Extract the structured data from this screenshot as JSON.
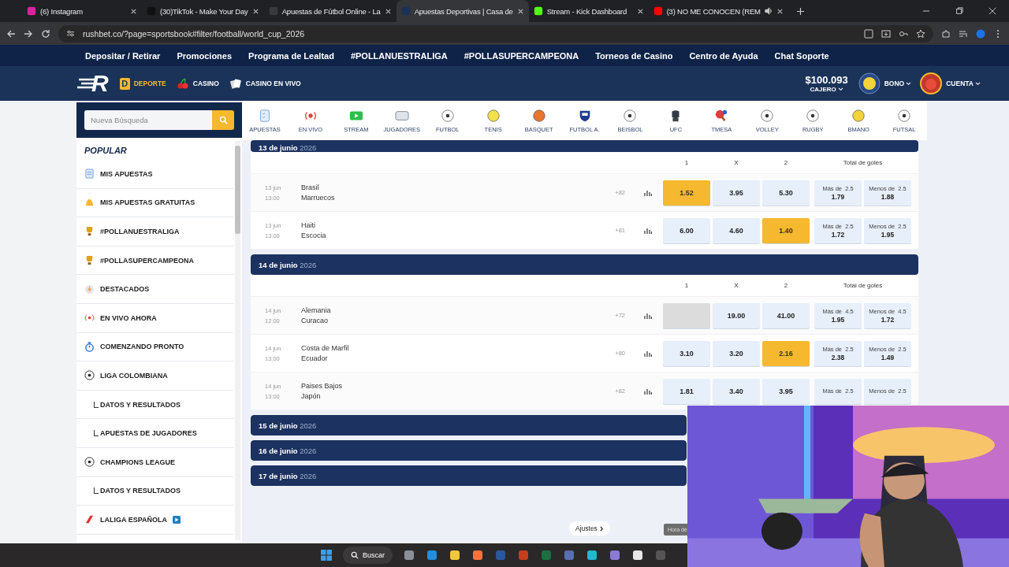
{
  "browser": {
    "tabs": [
      {
        "title": "(6) Instagram",
        "kind": "instagram",
        "selected": false,
        "audio": false
      },
      {
        "title": "(30)TikTok - Make Your Day",
        "kind": "tiktok",
        "selected": false,
        "audio": false
      },
      {
        "title": "Apuestas de Fútbol Online - La",
        "kind": "letter",
        "selected": false,
        "audio": false
      },
      {
        "title": "Apuestas Deportivas | Casa de",
        "kind": "site",
        "selected": true,
        "audio": false
      },
      {
        "title": "Stream - Kick Dashboard",
        "kind": "kick",
        "selected": false,
        "audio": false
      },
      {
        "title": "(3) NO ME CONOCEN (REM",
        "kind": "youtube",
        "selected": false,
        "audio": true
      }
    ],
    "url": "rushbet.co/?page=sportsbook#filter/football/world_cup_2026"
  },
  "site_nav": [
    "Depositar / Retirar",
    "Promociones",
    "Programa de Lealtad",
    "#POLLANUESTRALIGA",
    "#POLLASUPERCAMPEONA",
    "Torneos de Casino",
    "Centro de Ayuda",
    "Chat Soporte"
  ],
  "header": {
    "logo": "R",
    "products": [
      {
        "label": "DEPORTE",
        "kind": "sport",
        "badge": "D",
        "selected": true
      },
      {
        "label": "CASINO",
        "kind": "cherries",
        "selected": false
      },
      {
        "label": "CASINO EN VIVO",
        "kind": "cards",
        "selected": false
      }
    ],
    "balance": "$100.093",
    "cashier": "CAJERO",
    "bonus": "BONO",
    "account": "CUENTA"
  },
  "search": {
    "placeholder": "Nueva Búsqueda"
  },
  "sidebar": {
    "heading": "POPULAR",
    "items": [
      {
        "label": "MIS APUESTAS",
        "kind": "slip"
      },
      {
        "label": "MIS APUESTAS GRATUITAS",
        "kind": "bell"
      },
      {
        "label": "#POLLANUESTRALIGA",
        "kind": "trophy"
      },
      {
        "label": "#POLLASUPERCAMPEONA",
        "kind": "trophy"
      },
      {
        "label": "DESTACADOS",
        "kind": "bolt"
      },
      {
        "label": "EN VIVO AHORA",
        "kind": "live"
      },
      {
        "label": "COMENZANDO PRONTO",
        "kind": "timer"
      },
      {
        "label": "LIGA COLOMBIANA",
        "kind": "ball",
        "children": [
          {
            "label": "DATOS Y RESULTADOS"
          },
          {
            "label": "APUESTAS DE JUGADORES"
          }
        ]
      },
      {
        "label": "CHAMPIONS LEAGUE",
        "kind": "ball",
        "children": [
          {
            "label": "DATOS Y RESULTADOS"
          }
        ]
      },
      {
        "label": "LALIGA ESPAÑOLA",
        "kind": "flag",
        "video": true
      }
    ]
  },
  "sports": [
    {
      "label": "APUESTAS",
      "kind": "clipboard"
    },
    {
      "label": "EN VIVO",
      "kind": "live"
    },
    {
      "label": "STREAM",
      "kind": "play"
    },
    {
      "label": "JUGADORES",
      "kind": "badge"
    },
    {
      "label": "FUTBOL",
      "kind": "ball"
    },
    {
      "label": "TENIS",
      "kind": "ball",
      "color": "#f2e24a"
    },
    {
      "label": "BASQUET",
      "kind": "ball",
      "color": "#e8762c"
    },
    {
      "label": "FUTBOL A.",
      "kind": "shield"
    },
    {
      "label": "BEISBOL",
      "kind": "ball"
    },
    {
      "label": "UFC",
      "kind": "glove"
    },
    {
      "label": "TMESA",
      "kind": "paddle"
    },
    {
      "label": "VOLLEY",
      "kind": "ball"
    },
    {
      "label": "RUGBY",
      "kind": "ball"
    },
    {
      "label": "BMANO",
      "kind": "ball",
      "color": "#f3d23a"
    },
    {
      "label": "FUTSAL",
      "kind": "ball"
    }
  ],
  "days": [
    {
      "date": "13 de junio",
      "year": "2026",
      "expanded": true,
      "columns": [
        "1",
        "X",
        "2",
        "Total de goles"
      ],
      "matches": [
        {
          "day": "13 jun",
          "time": "13:00",
          "home": "Brasil",
          "away": "Marruecos",
          "markets": "+82",
          "odds": [
            {
              "value": "1.52",
              "selected": true,
              "disabled": false
            },
            {
              "value": "3.95",
              "selected": false,
              "disabled": false
            },
            {
              "value": "5.30",
              "selected": false,
              "disabled": false
            }
          ],
          "totals": [
            {
              "label": "Más de",
              "line": "2.5",
              "value": "1.79"
            },
            {
              "label": "Menos de",
              "line": "2.5",
              "value": "1.88"
            }
          ]
        },
        {
          "day": "13 jun",
          "time": "13:00",
          "home": "Haiti",
          "away": "Escocia",
          "markets": "+81",
          "odds": [
            {
              "value": "6.00",
              "selected": false,
              "disabled": false
            },
            {
              "value": "4.60",
              "selected": false,
              "disabled": false
            },
            {
              "value": "1.40",
              "selected": true,
              "disabled": false
            }
          ],
          "totals": [
            {
              "label": "Más de",
              "line": "2.5",
              "value": "1.72"
            },
            {
              "label": "Menos de",
              "line": "2.5",
              "value": "1.95"
            }
          ]
        }
      ]
    },
    {
      "date": "14 de junio",
      "year": "2026",
      "expanded": true,
      "columns": [
        "1",
        "X",
        "2",
        "Total de goles"
      ],
      "matches": [
        {
          "day": "14 jun",
          "time": "12:00",
          "home": "Alemania",
          "away": "Curacao",
          "markets": "+72",
          "odds": [
            {
              "selected": false,
              "disabled": true
            },
            {
              "value": "19.00",
              "selected": false,
              "disabled": false
            },
            {
              "value": "41.00",
              "selected": false,
              "disabled": false
            }
          ],
          "totals": [
            {
              "label": "Más de",
              "line": "4.5",
              "value": "1.95"
            },
            {
              "label": "Menos de",
              "line": "4.5",
              "value": "1.72"
            }
          ]
        },
        {
          "day": "14 jun",
          "time": "13:00",
          "home": "Costa de Marfil",
          "away": "Ecuador",
          "markets": "+80",
          "odds": [
            {
              "value": "3.10",
              "selected": false,
              "disabled": false
            },
            {
              "value": "3.20",
              "selected": false,
              "disabled": false
            },
            {
              "value": "2.16",
              "selected": true,
              "disabled": false
            }
          ],
          "totals": [
            {
              "label": "Más de",
              "line": "2.5",
              "value": "2.38"
            },
            {
              "label": "Menos de",
              "line": "2.5",
              "value": "1.49"
            }
          ]
        },
        {
          "day": "14 jun",
          "time": "13:00",
          "home": "Paises Bajos",
          "away": "Japón",
          "markets": "+82",
          "odds": [
            {
              "value": "1.81",
              "selected": false,
              "disabled": false
            },
            {
              "value": "3.40",
              "selected": false,
              "disabled": false
            },
            {
              "value": "3.95",
              "selected": false,
              "disabled": false
            }
          ],
          "totals": [
            {
              "label": "Más de",
              "line": "2.5"
            },
            {
              "label": "Menos de",
              "line": "2.5"
            }
          ]
        }
      ]
    },
    {
      "date": "15 de junio",
      "year": "2026",
      "expanded": false
    },
    {
      "date": "16 de junio",
      "year": "2026",
      "expanded": false
    },
    {
      "date": "17 de junio",
      "year": "2026",
      "expanded": false
    }
  ],
  "footer": {
    "settings": "Ajustes",
    "time_badge": "Hora de"
  },
  "taskbar": {
    "search": "Buscar"
  }
}
